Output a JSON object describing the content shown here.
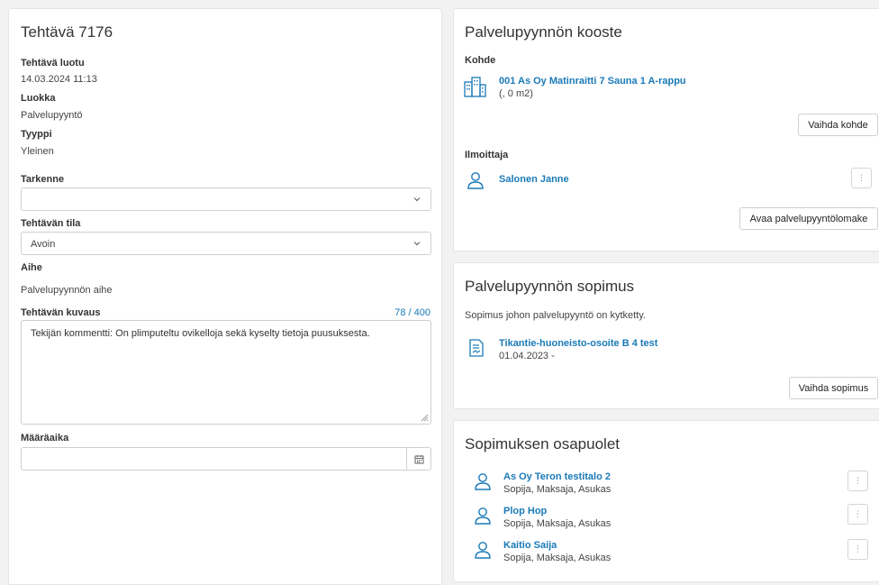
{
  "task": {
    "title": "Tehtävä 7176",
    "created_label": "Tehtävä luotu",
    "created_value": "14.03.2024 11:13",
    "class_label": "Luokka",
    "class_value": "Palvelupyyntö",
    "type_label": "Tyyppi",
    "type_value": "Yleinen",
    "specifier_label": "Tarkenne",
    "specifier_value": "",
    "status_label": "Tehtävän tila",
    "status_value": "Avoin",
    "subject_label": "Aihe",
    "subject_value": "Palvelupyynnön aihe",
    "description_label": "Tehtävän kuvaus",
    "description_counter": "78 / 400",
    "description_value": "Tekijän kommentti: On plimputeltu ovikelloja sekä kyselty tietoja puusuksesta.",
    "deadline_label": "Määräaika",
    "deadline_value": ""
  },
  "summary": {
    "title": "Palvelupyynnön kooste",
    "target_label": "Kohde",
    "target_name": "001 As Oy Matinraitti 7 Sauna 1 A-rappu",
    "target_sub": "(, 0 m2)",
    "change_target_button": "Vaihda kohde",
    "reporter_label": "Ilmoittaja",
    "reporter_name": "Salonen Janne",
    "open_form_button": "Avaa palvelupyyntölomake"
  },
  "contract": {
    "title": "Palvelupyynnön sopimus",
    "description": "Sopimus johon palvelupyyntö on kytketty.",
    "contract_name": "Tikantie-huoneisto-osoite B 4 test",
    "contract_date": "01.04.2023 -",
    "change_contract_button": "Vaihda sopimus"
  },
  "parties": {
    "title": "Sopimuksen osapuolet",
    "items": [
      {
        "name": "As Oy Teron testitalo 2",
        "roles": "Sopija, Maksaja, Asukas"
      },
      {
        "name": "Plop Hop",
        "roles": "Sopija, Maksaja, Asukas"
      },
      {
        "name": "Kaitio Saija",
        "roles": "Sopija, Maksaja, Asukas"
      }
    ]
  },
  "icons": {
    "chevron": "chevron-down-icon",
    "calendar": "calendar-icon",
    "building": "building-icon",
    "person": "person-icon",
    "document": "document-icon",
    "kebab": "kebab-menu-icon"
  },
  "colors": {
    "link": "#1a7ab8",
    "background": "#f2f2f2"
  }
}
